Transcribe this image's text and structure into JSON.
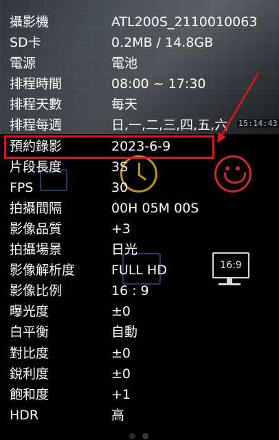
{
  "camera_overlay": {
    "timestamp": "15:14:43"
  },
  "settings": [
    {
      "label": "攝影機",
      "value": "ATL200S_2110010063"
    },
    {
      "label": "SD卡",
      "value": "0.2MB / 14.8GB"
    },
    {
      "label": "電源",
      "value": "電池"
    },
    {
      "label": "排程時間",
      "value": "08:00 ~ 17:30"
    },
    {
      "label": "排程天數",
      "value": "每天"
    },
    {
      "label": "排程每週",
      "value": "日,一,二,三,四,五,六"
    },
    {
      "label": "預約錄影",
      "value": "2023-6-9"
    },
    {
      "label": "片段長度",
      "value": "3S"
    },
    {
      "label": "FPS",
      "value": "30"
    },
    {
      "label": "拍攝間隔",
      "value": "00H 05M 00S"
    },
    {
      "label": "影像品質",
      "value": "+3"
    },
    {
      "label": "拍攝場景",
      "value": "日光"
    },
    {
      "label": "影像解析度",
      "value": "FULL HD"
    },
    {
      "label": "影像比例",
      "value": "16 : 9"
    },
    {
      "label": "曝光度",
      "value": "±0"
    },
    {
      "label": "白平衡",
      "value": "自動"
    },
    {
      "label": "對比度",
      "value": "±0"
    },
    {
      "label": "銳利度",
      "value": "±0"
    },
    {
      "label": "飽和度",
      "value": "+1"
    },
    {
      "label": "HDR",
      "value": "高"
    }
  ],
  "background_icons": {
    "monitor_ratio_label": "16:9"
  },
  "annotation": {
    "highlighted_row": "預約錄影",
    "color": "#e0151c"
  },
  "page_indicator": {
    "pages": 2,
    "current": 1
  }
}
